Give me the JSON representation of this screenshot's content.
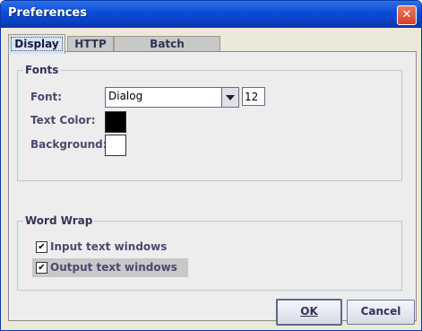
{
  "window": {
    "title": "Preferences",
    "close_glyph": "✕"
  },
  "tabs": [
    {
      "label": "Display",
      "active": true
    },
    {
      "label": "HTTP",
      "active": false
    },
    {
      "label": "Batch Processing",
      "active": false
    }
  ],
  "fonts_group": {
    "title": "Fonts",
    "font_label": "Font:",
    "font_value": "Dialog",
    "size_value": "12",
    "text_color_label": "Text Color:",
    "text_color": "#000000",
    "background_label": "Background:",
    "background_color": "#ffffff"
  },
  "wrap_group": {
    "title": "Word Wrap",
    "options": [
      {
        "label": "Input text windows",
        "checked": true,
        "check_glyph": "✔"
      },
      {
        "label": "Output text windows",
        "checked": true,
        "check_glyph": "✔"
      }
    ]
  },
  "buttons": {
    "ok_label": "OK",
    "cancel_label": "Cancel"
  },
  "icons": {
    "close": "close-icon",
    "dropdown": "chevron-down-icon",
    "check": "checkmark-icon"
  }
}
